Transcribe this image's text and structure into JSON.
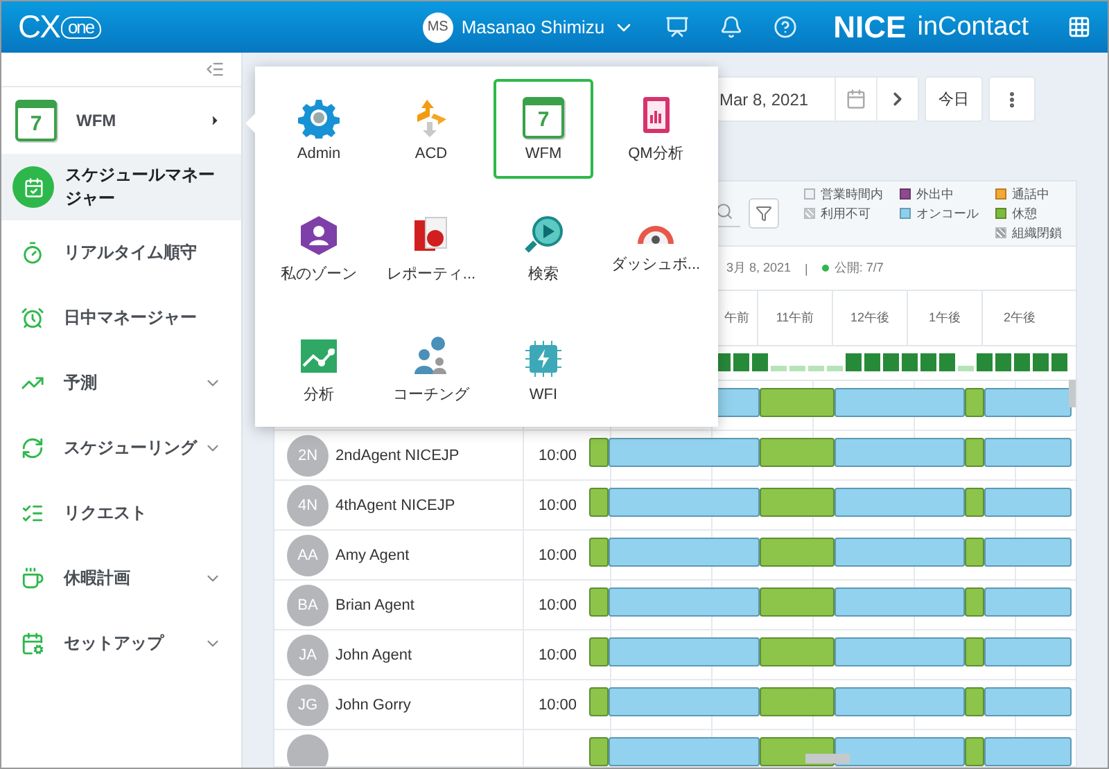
{
  "header": {
    "logo": {
      "text": "CX",
      "cloud_text": "one"
    },
    "user": {
      "initials": "MS",
      "name": "Masanao Shimizu"
    },
    "brand": {
      "name": "NICE",
      "product": "inContact"
    }
  },
  "sidebar": {
    "items": [
      {
        "label": "WFM",
        "kind": "module",
        "icon_text": "7",
        "selected": false,
        "expandable": false
      },
      {
        "label": "スケジュールマネージャー",
        "kind": "page",
        "selected": true,
        "expandable": false
      },
      {
        "label": "リアルタイム順守",
        "kind": "page",
        "selected": false,
        "expandable": false
      },
      {
        "label": "日中マネージャー",
        "kind": "page",
        "selected": false,
        "expandable": false
      },
      {
        "label": "予測",
        "kind": "page",
        "selected": false,
        "expandable": true
      },
      {
        "label": "スケジューリング",
        "kind": "page",
        "selected": false,
        "expandable": true
      },
      {
        "label": "リクエスト",
        "kind": "page",
        "selected": false,
        "expandable": false
      },
      {
        "label": "休暇計画",
        "kind": "page",
        "selected": false,
        "expandable": true
      },
      {
        "label": "セットアップ",
        "kind": "page",
        "selected": false,
        "expandable": true
      }
    ]
  },
  "app_menu": {
    "apps": [
      {
        "label": "Admin",
        "selected": false
      },
      {
        "label": "ACD",
        "selected": false
      },
      {
        "label": "WFM",
        "selected": true,
        "icon_text": "7"
      },
      {
        "label": "QM分析",
        "selected": false
      },
      {
        "label": "私のゾーン",
        "selected": false
      },
      {
        "label": "レポーティ...",
        "selected": false
      },
      {
        "label": "検索",
        "selected": false
      },
      {
        "label": "ダッシュボ...",
        "selected": false
      },
      {
        "label": "分析",
        "selected": false
      },
      {
        "label": "コーチング",
        "selected": false
      },
      {
        "label": "WFI",
        "selected": false
      }
    ]
  },
  "toolbar": {
    "date": "Mar 8, 2021",
    "today_button": "今日"
  },
  "schedule": {
    "legend": [
      {
        "label": "営業時間内",
        "color": "#eef2f6",
        "kind": "solid"
      },
      {
        "label": "外出中",
        "color": "#8e4a8e",
        "kind": "solid"
      },
      {
        "label": "通話中",
        "color": "#f5a833",
        "kind": "solid"
      },
      {
        "label": "利用不可",
        "color": "#c4c8cc",
        "kind": "hatched"
      },
      {
        "label": "オンコール",
        "color": "#8dd0ee",
        "kind": "solid"
      },
      {
        "label": "休憩",
        "color": "#7cbb3c",
        "kind": "solid"
      },
      {
        "label": "組織閉鎖",
        "color": "#9ea3a8",
        "kind": "hatched"
      }
    ],
    "date": "3月 8, 2021",
    "separator": "|",
    "published": "公開: 7/7",
    "hours": [
      "午前",
      "11午前",
      "12午後",
      "1午後",
      "2午後"
    ],
    "agents": [
      {
        "initials": "2N",
        "name": "2ndAgent NICEJP",
        "start": "10:00"
      },
      {
        "initials": "4N",
        "name": "4thAgent NICEJP",
        "start": "10:00"
      },
      {
        "initials": "AA",
        "name": "Amy Agent",
        "start": "10:00"
      },
      {
        "initials": "BA",
        "name": "Brian Agent",
        "start": "10:00"
      },
      {
        "initials": "JA",
        "name": "John Agent",
        "start": "10:00"
      },
      {
        "initials": "JG",
        "name": "John Gorry",
        "start": "10:00"
      }
    ]
  }
}
